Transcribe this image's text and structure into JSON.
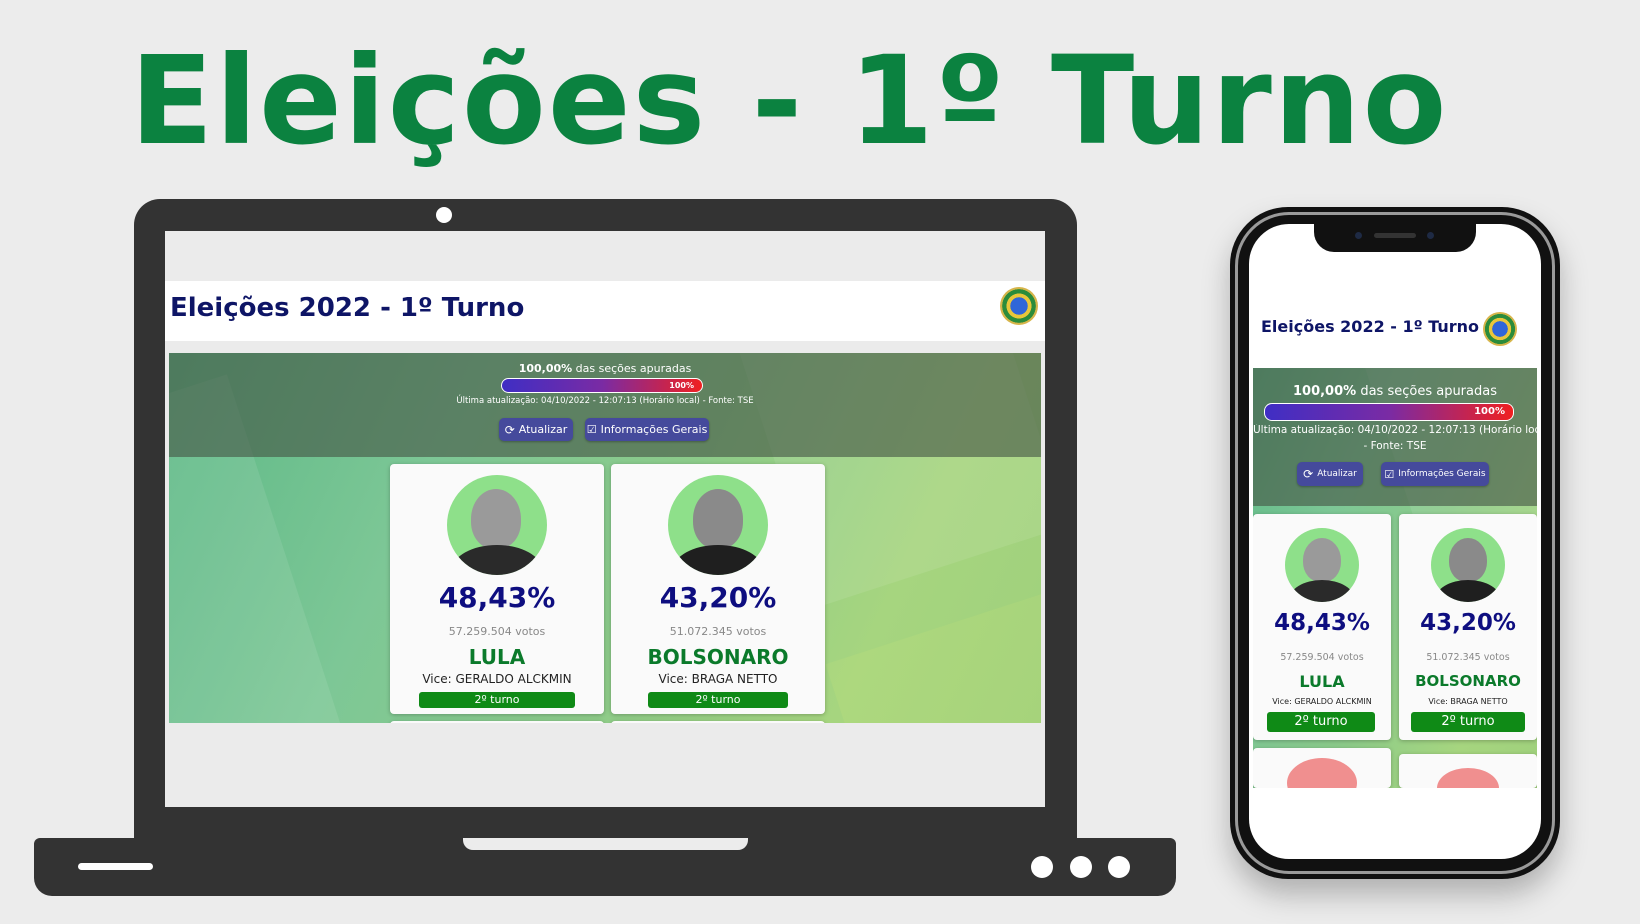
{
  "headline": "Eleições - 1º Turno",
  "app": {
    "title": "Eleições 2022 - 1º Turno",
    "apuracao_pct": "100,00%",
    "apuracao_text": "das seções apuradas",
    "progress": {
      "label": "100%",
      "fraction": 1.0
    },
    "updated": "Última atualização: 04/10/2022 - 12:07:13 (Horário local) - Fonte: TSE",
    "updated_line1": "Última atualização: 04/10/2022 - 12:07:13 (Horário local",
    "updated_line2": "- Fonte: TSE",
    "btn_atualizar": "Atualizar",
    "btn_info": "Informações Gerais",
    "candidates": [
      {
        "pct": "48,43%",
        "votes": "57.259.504 votos",
        "name": "LULA",
        "vice": "Vice: GERALDO ALCKMIN",
        "status": "2º turno"
      },
      {
        "pct": "43,20%",
        "votes": "51.072.345 votos",
        "name": "BOLSONARO",
        "vice": "Vice: BRAGA NETTO",
        "status": "2º turno"
      }
    ]
  },
  "colors": {
    "headline": "#0b8240",
    "title": "#0e1566",
    "percent": "#0e0e80",
    "candidate_name": "#0b7a2b",
    "turno_badge": "#0f8a16",
    "button": "#454a9c"
  }
}
